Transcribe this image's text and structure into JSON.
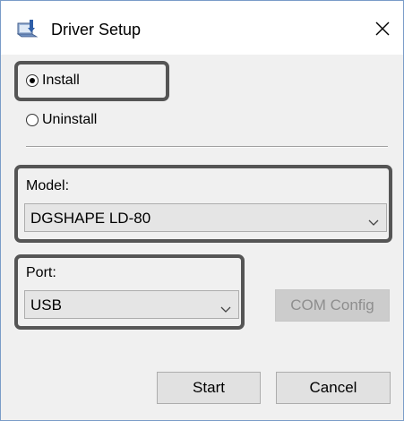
{
  "window": {
    "title": "Driver Setup"
  },
  "options": {
    "install_label": "Install",
    "uninstall_label": "Uninstall",
    "selected": "install"
  },
  "model": {
    "label": "Model:",
    "value": "DGSHAPE LD-80"
  },
  "port": {
    "label": "Port:",
    "value": "USB"
  },
  "buttons": {
    "com_config": "COM Config",
    "start": "Start",
    "cancel": "Cancel"
  },
  "icons": {
    "app": "driver-setup-icon",
    "close": "close-icon",
    "dropdown": "chevron-down-icon"
  },
  "colors": {
    "highlight_border": "#555555",
    "window_border": "#7a9cc8"
  }
}
